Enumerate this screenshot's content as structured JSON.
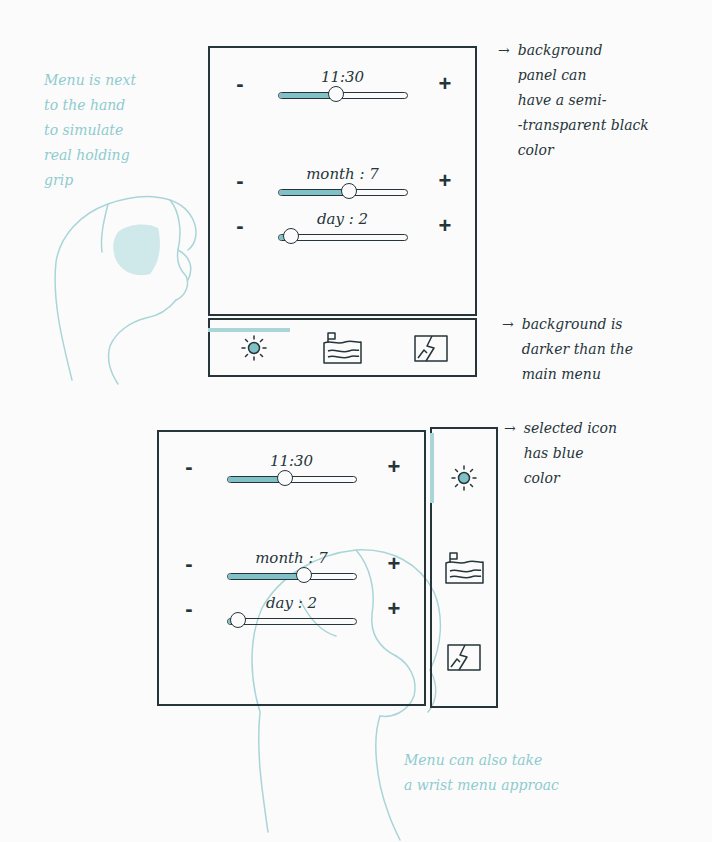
{
  "sketches": [
    {
      "kind": "bottom-bar",
      "sliders": [
        {
          "label": "11:30",
          "decrement": "-",
          "increment": "+",
          "level": 0.45
        },
        {
          "label": "month : 7",
          "decrement": "-",
          "increment": "+",
          "level": 0.55
        },
        {
          "label": "day : 2",
          "decrement": "-",
          "increment": "+",
          "level": 0.1
        }
      ],
      "tabs": [
        {
          "kind": "sun",
          "selected": true
        },
        {
          "kind": "landscape",
          "selected": false
        },
        {
          "kind": "photo",
          "selected": false
        }
      ]
    },
    {
      "kind": "side-bar",
      "sliders": [
        {
          "label": "11:30",
          "decrement": "-",
          "increment": "+",
          "level": 0.45
        },
        {
          "label": "month : 7",
          "decrement": "-",
          "increment": "+",
          "level": 0.6
        },
        {
          "label": "day : 2",
          "decrement": "-",
          "increment": "+",
          "level": 0.08
        }
      ],
      "tabs": [
        {
          "kind": "sun",
          "selected": true
        },
        {
          "kind": "landscape",
          "selected": false
        },
        {
          "kind": "photo",
          "selected": false
        }
      ]
    }
  ],
  "notes": [
    {
      "arrow": "",
      "lines": [
        "Menu is next",
        "to the hand",
        "to simulate",
        "real holding",
        "grip"
      ],
      "color": "#8ecbcf"
    },
    {
      "arrow": "→",
      "lines": [
        "background",
        "panel can",
        "have a semi-",
        "-transparent black",
        "color"
      ],
      "color": "#26353a"
    },
    {
      "arrow": "→",
      "lines": [
        "background is",
        "darker than the",
        "main menu"
      ],
      "color": "#26353a"
    },
    {
      "arrow": "→",
      "lines": [
        "selected icon",
        "has blue",
        "color"
      ],
      "color": "#26353a"
    },
    {
      "arrow": "",
      "lines": [
        "Menu can also take",
        "a wrist menu approac"
      ],
      "color": "#8ecbcf"
    }
  ]
}
